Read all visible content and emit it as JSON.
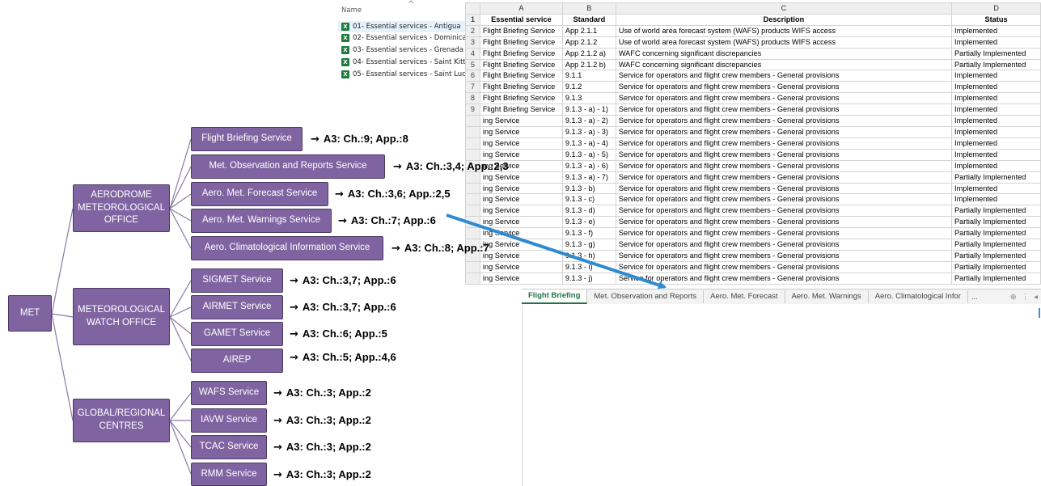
{
  "file_list": {
    "header": "Name",
    "files": [
      "01- Essential services - Antigua",
      "02- Essential services - Dominica",
      "03- Essential services - Grenada",
      "04- Essential services - Saint Kitts & N",
      "05- Essential services - Saint Lucia"
    ]
  },
  "spreadsheet": {
    "column_letters": [
      "A",
      "B",
      "C",
      "D"
    ],
    "rows": [
      [
        "1",
        "Essential service",
        "Standard",
        "Description",
        "Status"
      ],
      [
        "2",
        "Flight Briefing Service",
        "App 2.1.1",
        "Use of world area forecast system (WAFS) products WIFS access",
        "Implemented"
      ],
      [
        "3",
        "Flight Briefing Service",
        "App 2.1.2",
        "Use of world area forecast system (WAFS) products WIFS access",
        "Implemented"
      ],
      [
        "4",
        "Flight Briefing Service",
        "App 2.1.2 a)",
        "WAFC concerning significant discrepancies",
        "Partially Implemented"
      ],
      [
        "5",
        "Flight Briefing Service",
        "App 2.1.2 b)",
        "WAFC concerning significant discrepancies",
        "Partially Implemented"
      ],
      [
        "6",
        "Flight Briefing Service",
        "9.1.1",
        "Service for operators and flight crew members - General provisions",
        "Implemented"
      ],
      [
        "7",
        "Flight Briefing Service",
        "9.1.2",
        "Service for operators and flight crew members - General provisions",
        "Implemented"
      ],
      [
        "8",
        "Flight Briefing Service",
        "9.1.3",
        "Service for operators and flight crew members - General provisions",
        "Implemented"
      ],
      [
        "9",
        "Flight Briefing Service",
        "9.1.3 - a) - 1)",
        "Service for operators and flight crew members - General provisions",
        "Implemented"
      ],
      [
        "",
        "ing Service",
        "9.1.3 - a) - 2)",
        "Service for operators and flight crew members - General provisions",
        "Implemented"
      ],
      [
        "",
        "ing Service",
        "9.1.3 - a) - 3)",
        "Service for operators and flight crew members - General provisions",
        "Implemented"
      ],
      [
        "",
        "ing Service",
        "9.1.3 - a) - 4)",
        "Service for operators and flight crew members - General provisions",
        "Implemented"
      ],
      [
        "",
        "ing Service",
        "9.1.3 - a) - 5)",
        "Service for operators and flight crew members - General provisions",
        "Implemented"
      ],
      [
        "",
        "ing Service",
        "9.1.3 - a) - 6)",
        "Service for operators and flight crew members - General provisions",
        "Implemented"
      ],
      [
        "",
        "ing Service",
        "9.1.3 - a) - 7)",
        "Service for operators and flight crew members - General provisions",
        "Partially Implemented"
      ],
      [
        "",
        "ing Service",
        "9.1.3 - b)",
        "Service for operators and flight crew members - General provisions",
        "Implemented"
      ],
      [
        "",
        "ing Service",
        "9.1.3 - c)",
        "Service for operators and flight crew members - General provisions",
        "Implemented"
      ],
      [
        "",
        "ing Service",
        "9.1.3 - d)",
        "Service for operators and flight crew members - General provisions",
        "Partially Implemented"
      ],
      [
        "",
        "ing Service",
        "9.1.3 - e)",
        "Service for operators and flight crew members - General provisions",
        "Partially Implemented"
      ],
      [
        "",
        "ing Service",
        "9.1.3 - f)",
        "Service for operators and flight crew members - General provisions",
        "Partially Implemented"
      ],
      [
        "",
        "ing Service",
        "9.1.3 - g)",
        "Service for operators and flight crew members - General provisions",
        "Partially Implemented"
      ],
      [
        "",
        "ing Service",
        "9.1.3 - h)",
        "Service for operators and flight crew members - General provisions",
        "Partially Implemented"
      ],
      [
        "",
        "ing Service",
        "9.1.3 - i)",
        "Service for operators and flight crew members - General provisions",
        "Partially Implemented"
      ],
      [
        "",
        "ing Service",
        "9.1.3 - j)",
        "Service for operators and flight crew members - General provisions",
        "Partially Implemented"
      ]
    ],
    "sheet_tabs": [
      "Flight Briefing",
      "Met. Observation and Reports",
      "Aero. Met. Forecast",
      "Aero. Met. Warnings",
      "Aero. Climatological Infor"
    ],
    "more_tabs": "...",
    "add_sheet_icon": "plus-circle-icon"
  },
  "diagram": {
    "root": "MET",
    "offices": [
      {
        "name": "AERODROME METEOROLOGICAL OFFICE",
        "services": [
          {
            "name": "Flight Briefing Service",
            "ref": "A3: Ch.:9; App.:8"
          },
          {
            "name": "Met. Observation and Reports Service",
            "ref": "A3: Ch.:3,4; App.:2,3"
          },
          {
            "name": "Aero. Met. Forecast Service",
            "ref": "A3: Ch.:3,6; App.:2,5"
          },
          {
            "name": "Aero. Met. Warnings Service",
            "ref": "A3: Ch.:7; App.:6"
          },
          {
            "name": "Aero. Climatological Information Service",
            "ref": "A3: Ch.:8; App.:7"
          }
        ]
      },
      {
        "name": "METEOROLOGICAL WATCH OFFICE",
        "services": [
          {
            "name": "SIGMET Service",
            "ref": "A3: Ch.:3,7; App.:6"
          },
          {
            "name": "AIRMET Service",
            "ref": "A3: Ch.:3,7; App.:6"
          },
          {
            "name": "GAMET Service",
            "ref": "A3: Ch.:6; App.:5"
          },
          {
            "name": "AIREP",
            "ref": "A3: Ch.:5; App.:4,6"
          }
        ]
      },
      {
        "name": "GLOBAL/REGIONAL CENTRES",
        "services": [
          {
            "name": "WAFS Service",
            "ref": "A3: Ch.:3; App.:2"
          },
          {
            "name": "IAVW Service",
            "ref": "A3: Ch.:3; App.:2"
          },
          {
            "name": "TCAC Service",
            "ref": "A3: Ch.:3; App.:2"
          },
          {
            "name": "RMM Service",
            "ref": "A3: Ch.:3; App.:2"
          }
        ]
      }
    ],
    "colors": {
      "node_fill": "#8064a2",
      "node_border": "#4b3a63",
      "connector": "#8a78a8",
      "callout_arrow": "#2e8bd0"
    },
    "arrow_glyph": "→"
  }
}
